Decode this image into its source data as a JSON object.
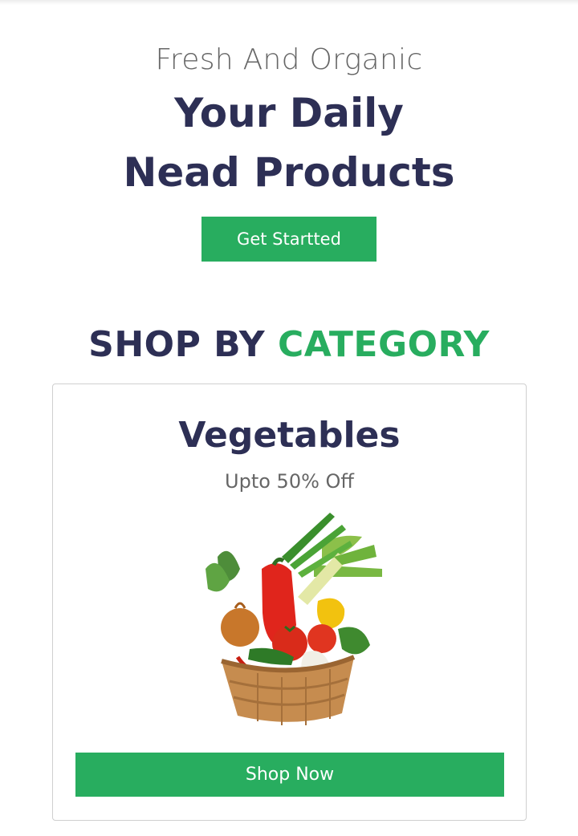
{
  "hero": {
    "subtitle": "Fresh And Organic",
    "title": "Your Daily Nead Products",
    "button_label": "Get Startted"
  },
  "category_section": {
    "heading_part1": "SHOP BY",
    "heading_part2": "CATEGORY"
  },
  "category_card": {
    "title": "Vegetables",
    "discount": "Upto 50% Off",
    "image_icon": "vegetable-basket-image",
    "button_label": "Shop Now"
  },
  "colors": {
    "accent_green": "#28ad5f",
    "heading_navy": "#2d2f55",
    "muted_text": "#666666"
  }
}
